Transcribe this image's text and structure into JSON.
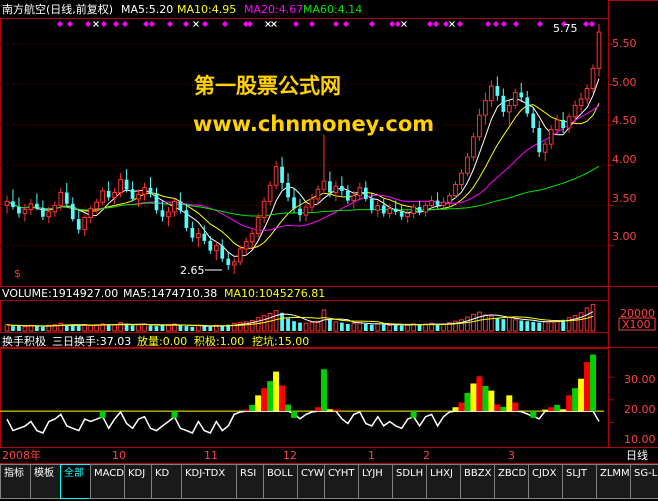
{
  "colors": {
    "bg": "#000000",
    "frame": "#b00000",
    "up": "#ff3232",
    "down": "#54fcfc",
    "ma5": "#ffffff",
    "ma10": "#ffff00",
    "ma20": "#ff00ff",
    "ma60": "#00e600",
    "watermark": "#ffd200",
    "diamond": "#ff00ff",
    "cross": "#ffffff",
    "green_bar": "#00d000",
    "red_bar": "#ff0000",
    "yellow_bar": "#ffff00",
    "tab_active": "#00ffff"
  },
  "chart": {
    "stock": "南方航空(日线,前复权)",
    "ma5_label": "MA5:5.20",
    "ma10_label": "MA10:4.95",
    "ma20_label": "MA20:4.67",
    "ma60_label": "MA60:4.14",
    "price_axis": [
      "5.50",
      "5.00",
      "4.50",
      "4.00",
      "3.50",
      "3.00"
    ],
    "high_label": "5.75",
    "low_label": "2.65",
    "s_marker": "$",
    "watermark_line1": "第一股票公式网",
    "watermark_line2": "www.chnmoney.com"
  },
  "volume": {
    "label": "VOLUME:1914927.00",
    "ma5": "MA5:1474710.38",
    "ma10": "MA10:1045276.81",
    "axis_top": "20000",
    "axis_unit": "X100"
  },
  "indicator": {
    "name": "换手积极",
    "turnover": "三日换手:37.03",
    "volume_flag": "放量:0.00",
    "active_flag": "积极:1.00",
    "dig_flag": "挖坑:15.00",
    "axis": [
      "30.00",
      "20.00",
      "10.00"
    ]
  },
  "date_axis": [
    "2008年",
    "10",
    "11",
    "12",
    "1",
    "2",
    "3"
  ],
  "period_label": "日线",
  "tabs": [
    "指标",
    "模板",
    "全部",
    "MACD",
    "KDJ",
    "KD",
    "KDJ-TDX",
    "RSI",
    "BOLL",
    "CYW",
    "CYHT",
    "LYJH",
    "SDLH",
    "LHXJ",
    "BBZX",
    "ZBCD",
    "CJDX",
    "SLJT",
    "ZLMM",
    "SG-LB"
  ],
  "active_tab_index": 2,
  "chart_data": [
    {
      "type": "candlestick",
      "title": "南方航空(日线,前复权)",
      "x_ticks": [
        "2008年",
        "10",
        "11",
        "12",
        "1",
        "2",
        "3"
      ],
      "y_ticks": [
        3.0,
        3.5,
        4.0,
        4.5,
        5.0,
        5.5
      ],
      "ylim": [
        2.55,
        5.8
      ],
      "series": [
        {
          "name": "MA5",
          "last": 5.2
        },
        {
          "name": "MA10",
          "last": 4.95
        },
        {
          "name": "MA20",
          "last": 4.67
        },
        {
          "name": "MA60",
          "last": 4.14
        }
      ],
      "ohlc": [
        [
          3.5,
          3.62,
          3.4,
          3.55
        ],
        [
          3.55,
          3.7,
          3.45,
          3.48
        ],
        [
          3.48,
          3.6,
          3.35,
          3.4
        ],
        [
          3.4,
          3.52,
          3.3,
          3.45
        ],
        [
          3.45,
          3.58,
          3.38,
          3.52
        ],
        [
          3.52,
          3.65,
          3.44,
          3.47
        ],
        [
          3.47,
          3.56,
          3.32,
          3.36
        ],
        [
          3.36,
          3.48,
          3.28,
          3.42
        ],
        [
          3.42,
          3.55,
          3.36,
          3.5
        ],
        [
          3.5,
          3.72,
          3.44,
          3.66
        ],
        [
          3.66,
          3.78,
          3.48,
          3.52
        ],
        [
          3.52,
          3.6,
          3.3,
          3.33
        ],
        [
          3.33,
          3.45,
          3.15,
          3.2
        ],
        [
          3.2,
          3.38,
          3.12,
          3.35
        ],
        [
          3.35,
          3.5,
          3.28,
          3.46
        ],
        [
          3.46,
          3.58,
          3.4,
          3.54
        ],
        [
          3.54,
          3.72,
          3.5,
          3.68
        ],
        [
          3.68,
          3.8,
          3.56,
          3.6
        ],
        [
          3.6,
          3.72,
          3.52,
          3.66
        ],
        [
          3.66,
          3.9,
          3.6,
          3.82
        ],
        [
          3.82,
          3.95,
          3.66,
          3.7
        ],
        [
          3.7,
          3.8,
          3.55,
          3.58
        ],
        [
          3.58,
          3.7,
          3.48,
          3.64
        ],
        [
          3.64,
          3.78,
          3.56,
          3.72
        ],
        [
          3.72,
          3.85,
          3.6,
          3.64
        ],
        [
          3.64,
          3.72,
          3.4,
          3.44
        ],
        [
          3.44,
          3.55,
          3.3,
          3.36
        ],
        [
          3.36,
          3.48,
          3.24,
          3.42
        ],
        [
          3.42,
          3.58,
          3.36,
          3.55
        ],
        [
          3.55,
          3.66,
          3.4,
          3.44
        ],
        [
          3.44,
          3.52,
          3.18,
          3.22
        ],
        [
          3.22,
          3.3,
          3.05,
          3.1
        ],
        [
          3.1,
          3.22,
          2.98,
          3.15
        ],
        [
          3.15,
          3.25,
          3.02,
          3.06
        ],
        [
          3.06,
          3.12,
          2.9,
          2.94
        ],
        [
          2.94,
          3.05,
          2.82,
          3.0
        ],
        [
          3.0,
          3.08,
          2.8,
          2.84
        ],
        [
          2.84,
          2.92,
          2.7,
          2.76
        ],
        [
          2.76,
          2.85,
          2.65,
          2.8
        ],
        [
          2.8,
          3.0,
          2.76,
          2.96
        ],
        [
          2.96,
          3.1,
          2.9,
          3.05
        ],
        [
          3.05,
          3.2,
          2.98,
          3.15
        ],
        [
          3.15,
          3.4,
          3.1,
          3.35
        ],
        [
          3.35,
          3.6,
          3.28,
          3.55
        ],
        [
          3.55,
          3.8,
          3.5,
          3.75
        ],
        [
          3.75,
          4.05,
          3.7,
          3.98
        ],
        [
          3.98,
          4.1,
          3.7,
          3.78
        ],
        [
          3.78,
          3.9,
          3.55,
          3.6
        ],
        [
          3.6,
          3.72,
          3.4,
          3.46
        ],
        [
          3.46,
          3.58,
          3.3,
          3.38
        ],
        [
          3.38,
          3.52,
          3.3,
          3.48
        ],
        [
          3.48,
          3.64,
          3.42,
          3.58
        ],
        [
          3.58,
          3.75,
          3.5,
          3.7
        ],
        [
          3.7,
          4.38,
          3.65,
          3.8
        ],
        [
          3.8,
          3.92,
          3.6,
          3.66
        ],
        [
          3.66,
          3.8,
          3.55,
          3.74
        ],
        [
          3.74,
          3.86,
          3.62,
          3.68
        ],
        [
          3.68,
          3.75,
          3.52,
          3.56
        ],
        [
          3.56,
          3.68,
          3.46,
          3.62
        ],
        [
          3.62,
          3.78,
          3.56,
          3.72
        ],
        [
          3.72,
          3.8,
          3.55,
          3.58
        ],
        [
          3.58,
          3.66,
          3.4,
          3.44
        ],
        [
          3.44,
          3.56,
          3.36,
          3.5
        ],
        [
          3.5,
          3.58,
          3.36,
          3.4
        ],
        [
          3.4,
          3.52,
          3.34,
          3.46
        ],
        [
          3.46,
          3.56,
          3.38,
          3.42
        ],
        [
          3.42,
          3.5,
          3.32,
          3.36
        ],
        [
          3.36,
          3.46,
          3.28,
          3.4
        ],
        [
          3.4,
          3.52,
          3.34,
          3.48
        ],
        [
          3.48,
          3.56,
          3.38,
          3.42
        ],
        [
          3.42,
          3.54,
          3.36,
          3.5
        ],
        [
          3.5,
          3.62,
          3.44,
          3.56
        ],
        [
          3.56,
          3.66,
          3.46,
          3.5
        ],
        [
          3.5,
          3.6,
          3.44,
          3.54
        ],
        [
          3.54,
          3.66,
          3.48,
          3.62
        ],
        [
          3.62,
          3.8,
          3.58,
          3.76
        ],
        [
          3.76,
          3.95,
          3.7,
          3.9
        ],
        [
          3.9,
          4.15,
          3.86,
          4.1
        ],
        [
          4.1,
          4.4,
          4.05,
          4.35
        ],
        [
          4.35,
          4.7,
          4.3,
          4.62
        ],
        [
          4.62,
          4.9,
          4.5,
          4.8
        ],
        [
          4.8,
          5.05,
          4.72,
          4.98
        ],
        [
          4.98,
          5.1,
          4.8,
          4.86
        ],
        [
          4.86,
          4.95,
          4.6,
          4.66
        ],
        [
          4.66,
          4.8,
          4.5,
          4.74
        ],
        [
          4.74,
          4.95,
          4.7,
          4.9
        ],
        [
          4.9,
          5.02,
          4.78,
          4.84
        ],
        [
          4.84,
          4.92,
          4.6,
          4.64
        ],
        [
          4.64,
          4.72,
          4.4,
          4.46
        ],
        [
          4.46,
          4.55,
          4.1,
          4.16
        ],
        [
          4.16,
          4.3,
          4.05,
          4.26
        ],
        [
          4.26,
          4.5,
          4.2,
          4.44
        ],
        [
          4.44,
          4.62,
          4.38,
          4.56
        ],
        [
          4.56,
          4.66,
          4.4,
          4.46
        ],
        [
          4.46,
          4.64,
          4.4,
          4.6
        ],
        [
          4.6,
          4.8,
          4.52,
          4.74
        ],
        [
          4.74,
          4.9,
          4.66,
          4.82
        ],
        [
          4.82,
          5.0,
          4.76,
          4.95
        ],
        [
          4.95,
          5.25,
          4.9,
          5.2
        ],
        [
          5.2,
          5.75,
          5.1,
          5.65
        ]
      ]
    },
    {
      "type": "bar",
      "title": "VOLUME",
      "values": [
        9,
        7,
        8,
        6,
        8,
        7,
        6,
        8,
        9,
        11,
        9,
        8,
        7,
        9,
        8,
        9,
        10,
        8,
        9,
        12,
        10,
        8,
        9,
        10,
        8,
        7,
        9,
        8,
        10,
        8,
        7,
        6,
        8,
        7,
        6,
        8,
        7,
        9,
        11,
        12,
        13,
        15,
        19,
        22,
        25,
        29,
        26,
        18,
        14,
        12,
        11,
        12,
        14,
        30,
        16,
        13,
        12,
        10,
        11,
        12,
        10,
        9,
        10,
        9,
        8,
        9,
        8,
        9,
        10,
        9,
        10,
        11,
        9,
        10,
        12,
        14,
        16,
        20,
        24,
        27,
        23,
        21,
        18,
        17,
        19,
        16,
        15,
        14,
        13,
        12,
        13,
        14,
        15,
        16,
        19,
        22,
        26,
        33,
        38
      ],
      "ymax": 40
    },
    {
      "type": "area",
      "title": "换手积极",
      "yticks": [
        10,
        20,
        30
      ],
      "ylim": [
        0,
        42
      ]
    }
  ]
}
